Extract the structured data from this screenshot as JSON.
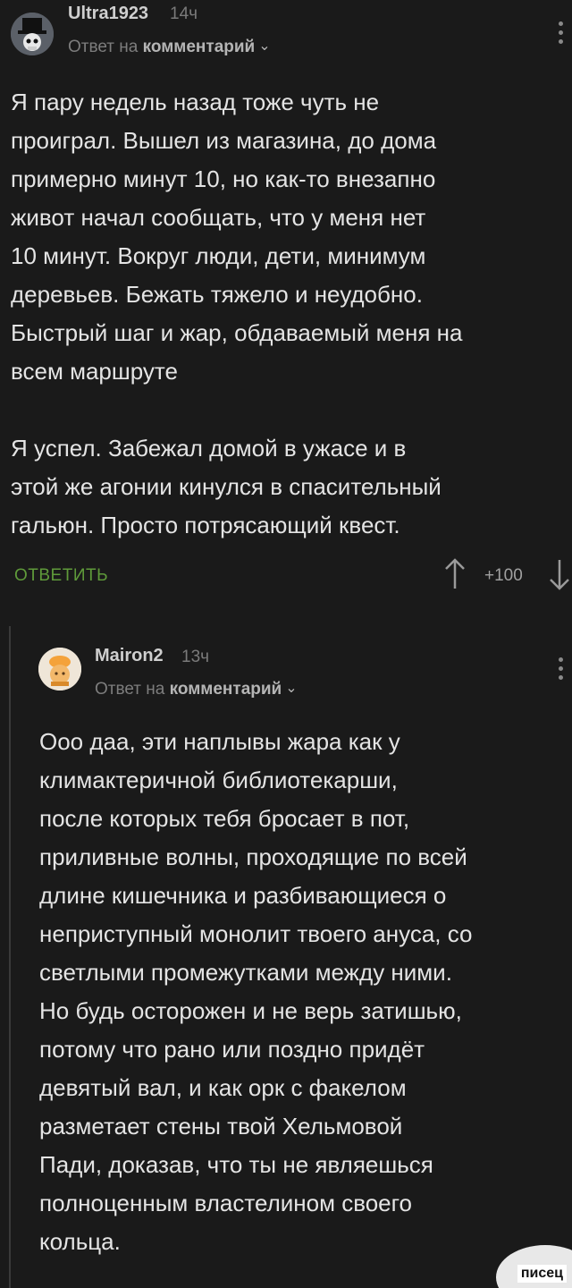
{
  "comments": [
    {
      "username": "Ultra1923",
      "time": "14ч",
      "reply_prefix": "Ответ на",
      "reply_link": "комментарий",
      "avatar_icon": "top-hat-skull-icon",
      "text": "Я пару недель назад тоже чуть не\nпроиграл. Вышел из магазина, до дома\nпримерно минут 10, но как-то внезапно\nживот начал сообщать, что у меня нет\n10 минут. Вокруг люди, дети, минимум\nдеревьев. Бежать тяжело и неудобно.\nБыстрый шаг и жар, обдаваемый меня на\nвсем маршруте\n\nЯ успел. Забежал домой в ужасе и в\nэтой же агонии кинулся в спасительный\nгальюн. Просто потрясающий квест.",
      "reply_button": "ОТВЕТИТЬ",
      "rating": "+100"
    },
    {
      "username": "Mairon2",
      "time": "13ч",
      "reply_prefix": "Ответ на",
      "reply_link": "комментарий",
      "avatar_icon": "cartoon-chef-avatar-icon",
      "text": "Ооо даа, эти наплывы жара как у\nклимактеричной библиотекарши,\nпосле которых тебя бросает в пот,\nприливные волны, проходящие по всей\nдлине кишечника и разбивающиеся о\nнеприступный монолит твоего ануса, со\nсветлыми промежутками между ними.\nНо будь осторожен и не верь затишью,\nпотому что рано или поздно придёт\nдевятый вал, и как орк с факелом\nразметает стены твой Хельмовой\nПади, доказав, что ты не являешься\nполноценным властелином своего\nкольца."
    }
  ],
  "watermark": "писец",
  "colors": {
    "background": "#1a1a1a",
    "reply_button": "#5f9a3a",
    "text": "#e4e4e4"
  }
}
